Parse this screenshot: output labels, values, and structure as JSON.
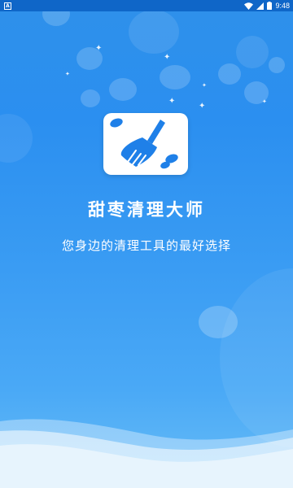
{
  "status_bar": {
    "left_icon": "A",
    "time": "9:48",
    "icons": [
      "wifi-icon",
      "signal-icon",
      "battery-icon"
    ]
  },
  "app": {
    "icon": "broom-icon",
    "title": "甜枣清理大师",
    "slogan": "您身边的清理工具的最好选择"
  },
  "colors": {
    "background_top": "#2e90ea",
    "background_bottom": "#68bdf7",
    "status_bar": "#0f66c8",
    "icon_blue": "#1f80e8"
  }
}
